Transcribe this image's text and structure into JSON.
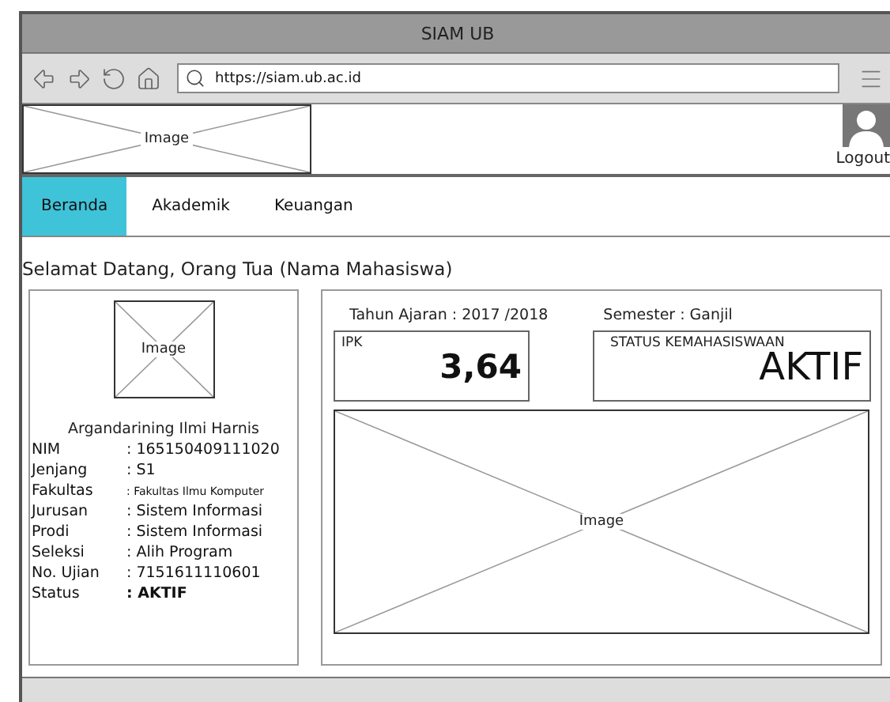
{
  "window": {
    "title": "SIAM UB"
  },
  "toolbar": {
    "url": "https://siam.ub.ac.id"
  },
  "header": {
    "logo_label": "Image",
    "logout": "Logout"
  },
  "tabs": [
    {
      "label": "Beranda",
      "selected": true
    },
    {
      "label": "Akademik",
      "selected": false
    },
    {
      "label": "Keuangan",
      "selected": false
    }
  ],
  "greeting": "Selamat Datang, Orang Tua (Nama Mahasiswa)",
  "profile": {
    "photo_label": "Image",
    "name": "Argandarining Ilmi Harnis",
    "fields": [
      {
        "label": "NIM",
        "value": ": 165150409111020",
        "kind": "plain"
      },
      {
        "label": "Jenjang",
        "value": ": S1",
        "kind": "plain"
      },
      {
        "label": "Fakultas",
        "value": ": Fakultas Ilmu Komputer",
        "kind": "small"
      },
      {
        "label": "Jurusan",
        "value": ": Sistem Informasi",
        "kind": "plain"
      },
      {
        "label": "Prodi",
        "value": ": Sistem Informasi",
        "kind": "plain"
      },
      {
        "label": "Seleksi",
        "value": ": Alih Program",
        "kind": "plain"
      },
      {
        "label": "No. Ujian",
        "value": ": 7151611110601",
        "kind": "plain"
      },
      {
        "label": "Status",
        "value": ": AKTIF",
        "kind": "bold"
      }
    ]
  },
  "summary": {
    "year": "Tahun Ajaran : 2017 /2018",
    "semester": "Semester : Ganjil",
    "ipk": {
      "label": "IPK",
      "value": "3,64"
    },
    "status": {
      "label": "STATUS KEMAHASISWAAN",
      "value": "AKTIF"
    },
    "chart_label": "Image"
  }
}
